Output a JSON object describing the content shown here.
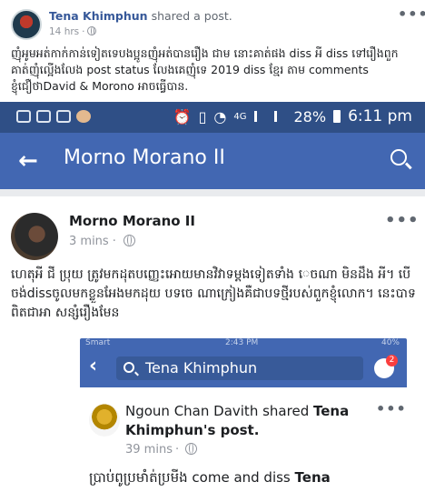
{
  "outer_post": {
    "author": "Tena Khimphun",
    "action": "shared a post.",
    "time": "14 hrs",
    "text": "ញុំអូមអត់កាក់កាន់ទៀតទេបងប្អូនញុំអត់បានរឿង ជាម នោះគាត់ផង diss អី diss ទៅរឿងពួកគាត់ញុំល្អើងលែង post status លែងគេញុំទេ 2019 diss ខ្មែរ តាម comments ខ្ញុំជឿថាDavid & Morono អាចធ្វើបាន."
  },
  "phone": {
    "status_bar": {
      "network": "4G",
      "battery": "28%",
      "time": "6:11 pm"
    },
    "app_bar": {
      "title": "Morno Morano II"
    },
    "inner_post": {
      "author": "Morno Morano II",
      "time": "3 mins",
      "text": "ហេតុអី ជី ប្រុយ ត្រូវមកដុតបញ្ញេះអោយមានវិវាទម្តងទៀតទាំង េចណា មិនដឹង អី។ បើចង់dissចូលមកខ្លួនអែងមកដុយ បទចេ ណាក្រៀងគឺជាបទថ្មីរបស់ពួកខ្ញុំលោក។ នេះបាទពិតជាអា សន្សំរឿងមែន"
    },
    "nested": {
      "status_left": "Smart",
      "status_time": "2:43 PM",
      "status_battery": "40%",
      "search_text": "Tena Khimphun",
      "badge": "2",
      "author": "Ngoun Chan Davith",
      "action": "shared",
      "shared_from": "Tena Khimphun's post.",
      "time": "39 mins",
      "text_prefix": "ប្រាប់ពូប្រមាំត់ប្រមីង",
      "text_mid": "come and diss",
      "text_bold": "Tena"
    }
  }
}
